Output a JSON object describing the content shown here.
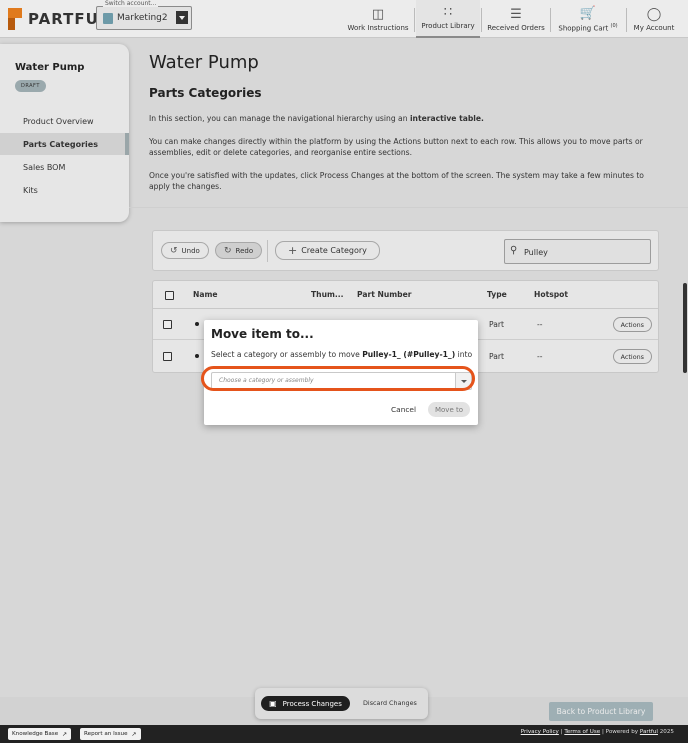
{
  "header": {
    "brand": "PARTFUL",
    "account_label": "Switch account...",
    "account_name": "Marketing2",
    "nav": [
      {
        "label": "Work Instructions",
        "icon": "monitor-icon"
      },
      {
        "label": "Product Library",
        "icon": "grid-icon"
      },
      {
        "label": "Received Orders",
        "icon": "list-check-icon"
      },
      {
        "label": "Shopping Cart",
        "count": "(0)",
        "icon": "cart-icon"
      },
      {
        "label": "My Account",
        "icon": "user-icon"
      }
    ]
  },
  "sidebar": {
    "title": "Water Pump",
    "badge": "DRAFT",
    "items": [
      {
        "label": "Product Overview"
      },
      {
        "label": "Parts Categories"
      },
      {
        "label": "Sales BOM"
      },
      {
        "label": "Kits"
      }
    ]
  },
  "main": {
    "page_title": "Water Pump",
    "section_title": "Parts Categories",
    "p1_a": "In this section, you can manage the navigational hierarchy using an ",
    "p1_b": "interactive table.",
    "p2": "You can make changes directly within the platform by using the Actions button next to each row. This allows you to move parts or assemblies, edit or delete categories, and reorganise entire sections.",
    "p3": "Once you're satisfied with the updates, click Process Changes at the bottom of the screen. The system may take a few minutes to apply the changes."
  },
  "toolbar": {
    "undo": "Undo",
    "redo": "Redo",
    "create": "Create Category",
    "search_value": "Pulley"
  },
  "table": {
    "columns": [
      "Name",
      "Thum...",
      "Part Number",
      "Type",
      "Hotspot"
    ],
    "rows": [
      {
        "type": "Part",
        "hotspot": "--",
        "action": "Actions"
      },
      {
        "type": "Part",
        "hotspot": "--",
        "action": "Actions"
      }
    ]
  },
  "modal": {
    "title": "Move item to...",
    "text_a": "Select a category or assembly to move ",
    "text_item": "Pulley-1_ (#Pulley-1_)",
    "text_b": " into",
    "placeholder": "Choose a category or assembly",
    "cancel": "Cancel",
    "move": "Move to",
    "highlight_color": "#e5541b"
  },
  "bottom": {
    "process": "Process Changes",
    "discard": "Discard Changes",
    "back": "Back to Product Library"
  },
  "footer": {
    "kb": "Knowledge Base",
    "report": "Report an Issue",
    "privacy": "Privacy Policy",
    "terms": "Terms of Use",
    "powered": "Powered by",
    "brand": "Partful",
    "year": "2025"
  }
}
